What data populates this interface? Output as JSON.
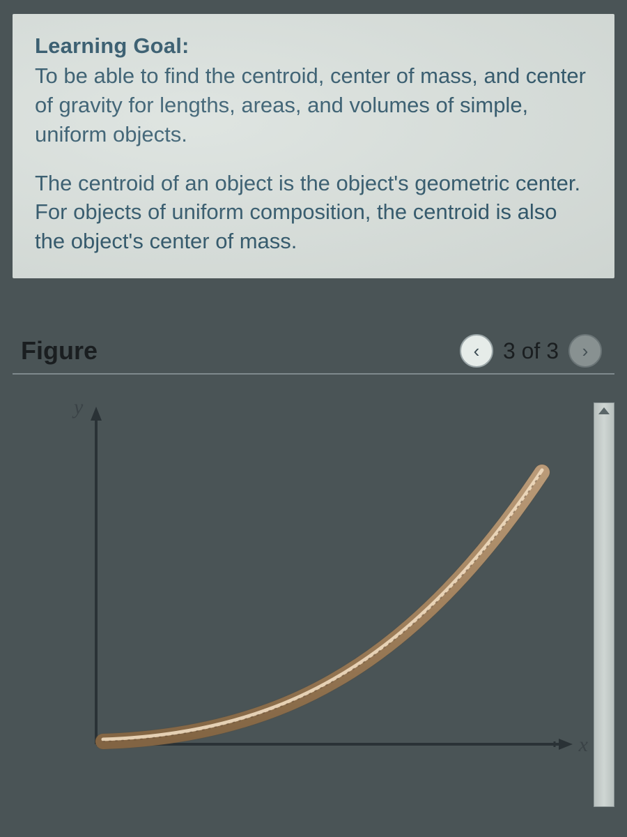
{
  "learning": {
    "title": "Learning Goal:",
    "body": "To be able to find the centroid, center of mass, and center of gravity for lengths, areas, and volumes of simple, uniform objects."
  },
  "description": "The centroid of an object is the object's geometric center. For objects of uniform composition, the centroid is also the object's center of mass.",
  "figure": {
    "label": "Figure",
    "pager": {
      "prev_glyph": "‹",
      "text": "3 of 3",
      "next_glyph": "›"
    },
    "axes": {
      "y_label": "y",
      "x_label": "x"
    }
  },
  "chart_data": {
    "type": "line",
    "title": "",
    "xlabel": "x",
    "ylabel": "y",
    "xlim": [
      0,
      1
    ],
    "ylim": [
      0,
      1
    ],
    "series": [
      {
        "name": "curve",
        "style": "thick-tube",
        "x": [
          0.0,
          0.1,
          0.2,
          0.3,
          0.4,
          0.5,
          0.6,
          0.7,
          0.8,
          0.9,
          1.0
        ],
        "y": [
          0.0,
          0.01,
          0.04,
          0.09,
          0.16,
          0.25,
          0.36,
          0.49,
          0.64,
          0.81,
          1.0
        ]
      }
    ],
    "grid": false,
    "legend": false
  }
}
